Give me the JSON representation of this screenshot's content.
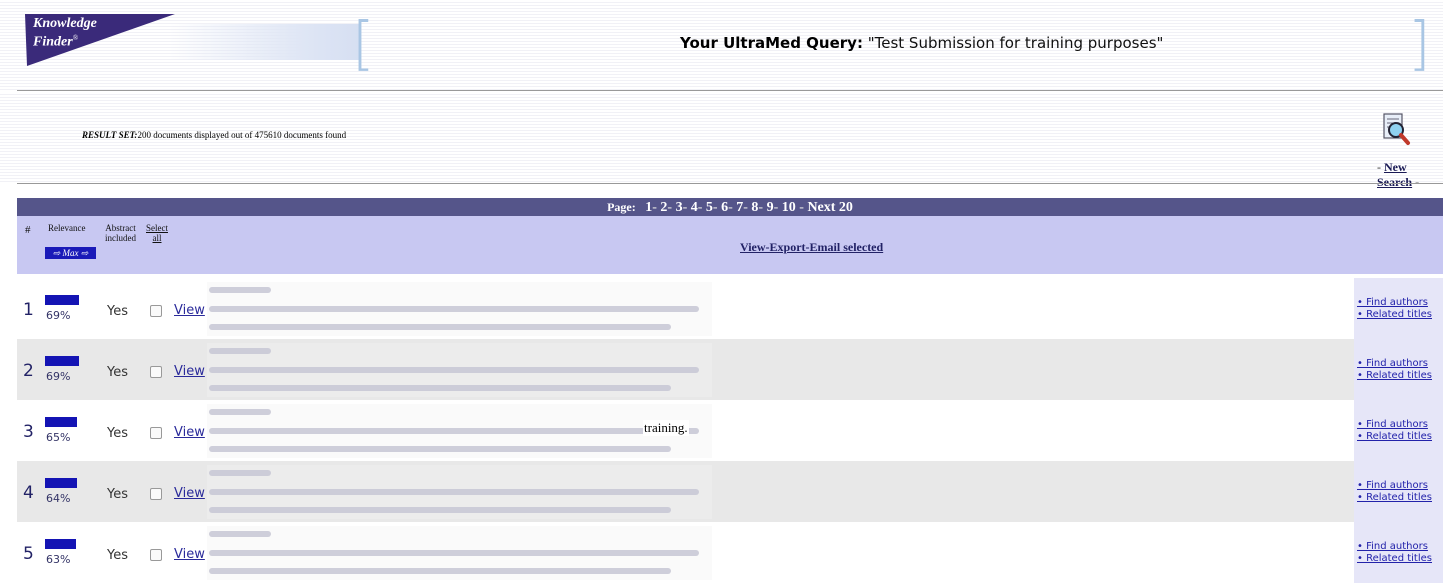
{
  "header": {
    "logo_line1": "Knowledge",
    "logo_line2": "Finder",
    "logo_mark": "®",
    "query_label": "Your UltraMed Query:",
    "query_text": "\"Test Submission for training purposes\""
  },
  "result_set": {
    "label": "RESULT SET:",
    "text": "200 documents displayed out of 475610 documents found",
    "new_search": "New Search",
    "dash": "-"
  },
  "pager": {
    "label": "Page:",
    "pages": [
      "1",
      "2",
      "3",
      "4",
      "5",
      "6",
      "7",
      "8",
      "9",
      "10"
    ],
    "next": "Next 20"
  },
  "columns": {
    "hash": "#",
    "relevance": "Relevance",
    "max": "⇨ Max ⇨",
    "abstract_line1": "Abstract",
    "abstract_line2": "included",
    "select_line1": "Select",
    "select_line2": "all",
    "view_export": "View-Export-Email selected"
  },
  "rows": [
    {
      "num": "1",
      "relevance": "69%",
      "relevance_fraction": 0.69,
      "abstract": "Yes",
      "view": "View",
      "find_authors": "• Find authors",
      "related_titles": "• Related titles",
      "visible_word": ""
    },
    {
      "num": "2",
      "relevance": "69%",
      "relevance_fraction": 0.69,
      "abstract": "Yes",
      "view": "View",
      "find_authors": "• Find authors",
      "related_titles": "• Related titles",
      "visible_word": ""
    },
    {
      "num": "3",
      "relevance": "65%",
      "relevance_fraction": 0.65,
      "abstract": "Yes",
      "view": "View",
      "find_authors": "• Find authors",
      "related_titles": "• Related titles",
      "visible_word": "training."
    },
    {
      "num": "4",
      "relevance": "64%",
      "relevance_fraction": 0.64,
      "abstract": "Yes",
      "view": "View",
      "find_authors": "• Find authors",
      "related_titles": "• Related titles",
      "visible_word": ""
    },
    {
      "num": "5",
      "relevance": "63%",
      "relevance_fraction": 0.63,
      "abstract": "Yes",
      "view": "View",
      "find_authors": "• Find authors",
      "related_titles": "• Related titles",
      "visible_word": ""
    }
  ],
  "colors": {
    "pager_bg": "#55558a",
    "header_row_bg": "#c8c8f2",
    "relevance_bar": "#1414b4",
    "logo_bg": "#3a2a7a"
  }
}
